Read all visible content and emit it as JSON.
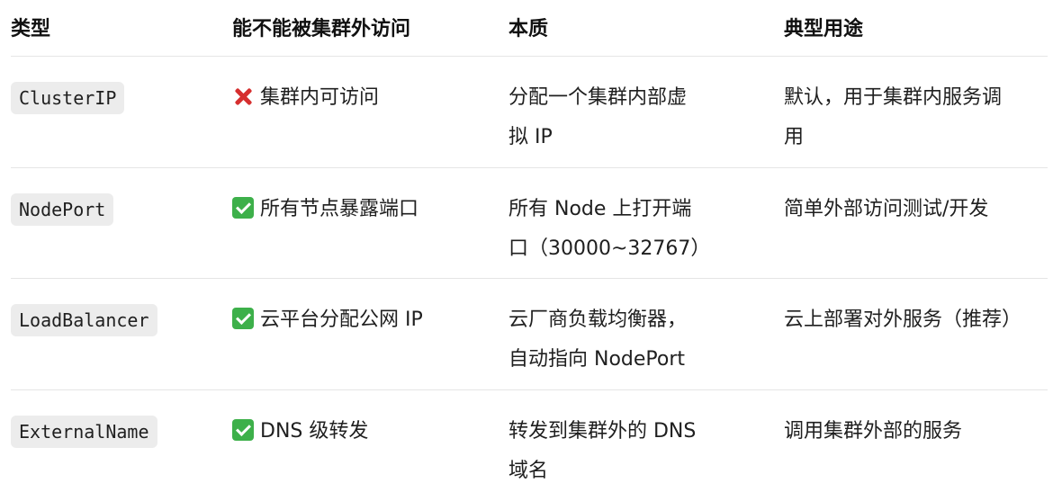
{
  "headers": {
    "type": "类型",
    "external_access": "能不能被集群外访问",
    "essence": "本质",
    "typical_use": "典型用途"
  },
  "rows": [
    {
      "type": "ClusterIP",
      "access_icon": "cross-mark-icon",
      "access": "集群内可访问",
      "essence_line1": "分配一个集群内部虚",
      "essence_line2": "拟 IP",
      "use_line1": "默认，用于集群内服务调",
      "use_line2": "用"
    },
    {
      "type": "NodePort",
      "access_icon": "check-mark-icon",
      "access": "所有节点暴露端口",
      "essence_line1": "所有 Node 上打开端",
      "essence_line2": "口（30000~32767）",
      "use_line1": "简单外部访问测试/开发",
      "use_line2": ""
    },
    {
      "type": "LoadBalancer",
      "access_icon": "check-mark-icon",
      "access": "云平台分配公网 IP",
      "essence_line1": "云厂商负载均衡器，",
      "essence_line2": "自动指向 NodePort",
      "use_line1": "云上部署对外服务（推荐）",
      "use_line2": ""
    },
    {
      "type": "ExternalName",
      "access_icon": "check-mark-icon",
      "access": "DNS 级转发",
      "essence_line1": "转发到集群外的 DNS",
      "essence_line2": "域名",
      "use_line1": "调用集群外部的服务",
      "use_line2": ""
    }
  ],
  "colors": {
    "text": "#1f1f1f",
    "header_text": "#111111",
    "divider": "#e5e5e5",
    "code_bg": "#ececec",
    "cross": "#d62f2f",
    "check": "#3db04a"
  }
}
